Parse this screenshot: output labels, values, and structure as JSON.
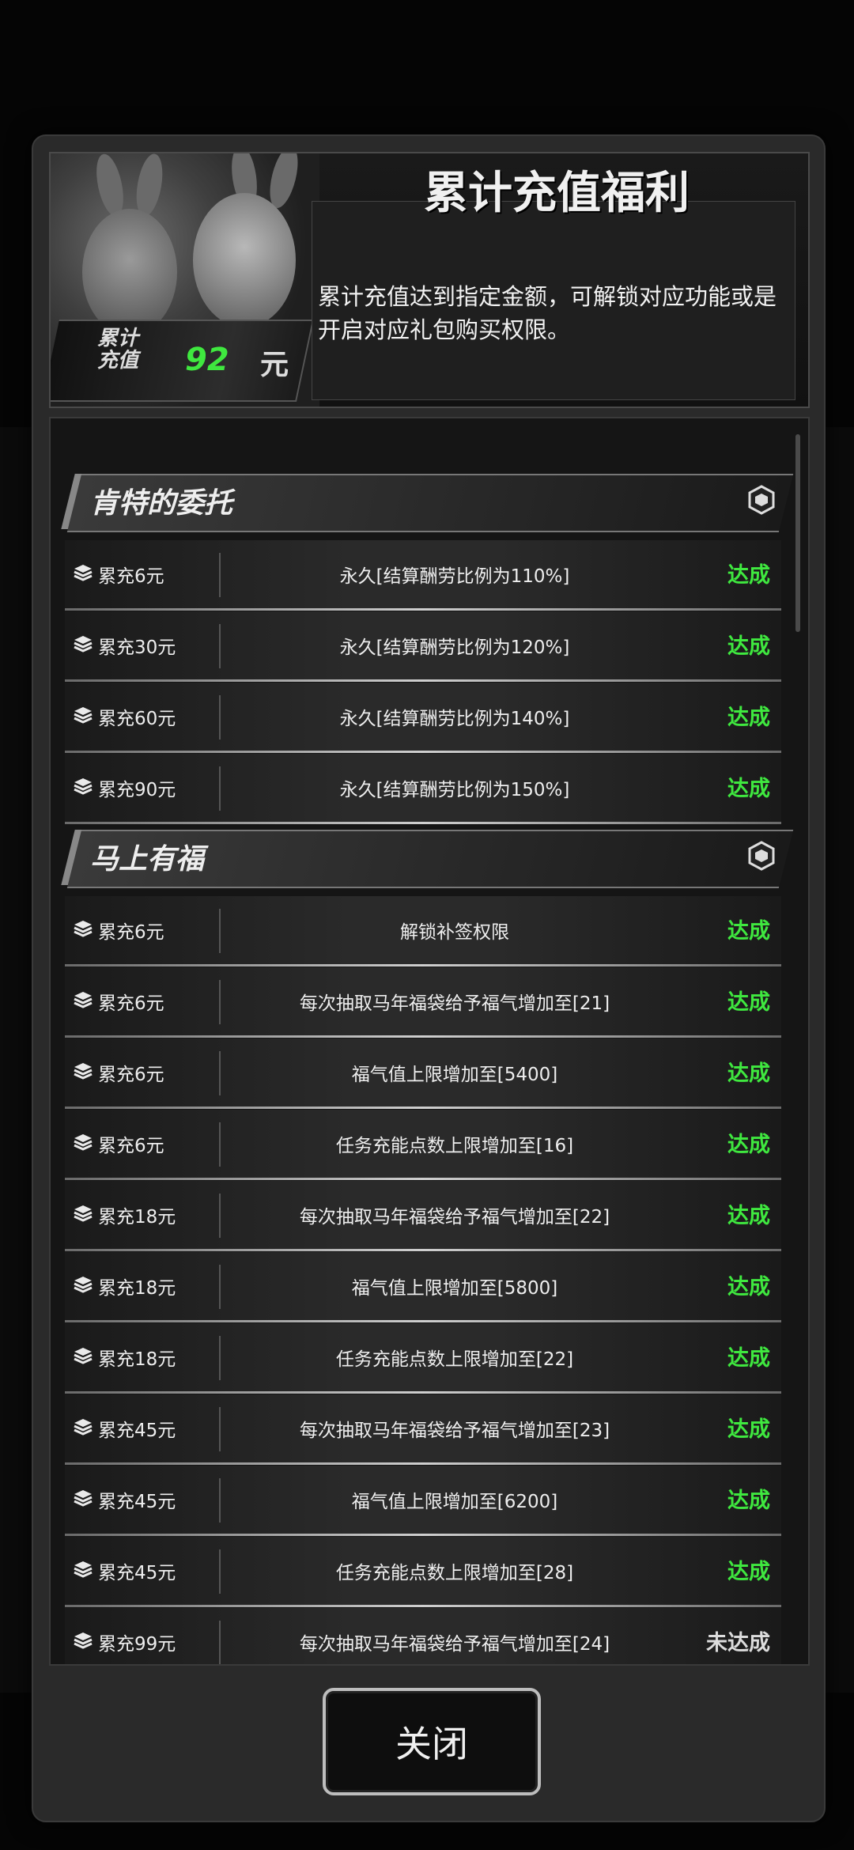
{
  "header": {
    "title": "累计充值福利",
    "description": "累计充值达到指定金额，可解锁对应功能或是开启对应礼包购买权限。",
    "badge_label_line1": "累计",
    "badge_label_line2": "充值",
    "total_amount": "92",
    "currency": "元"
  },
  "sections": [
    {
      "title": "肯特的委托",
      "rows": [
        {
          "req": "累充6元",
          "text": "永久[结算酬劳比例为110%]",
          "status": "达成"
        },
        {
          "req": "累充30元",
          "text": "永久[结算酬劳比例为120%]",
          "status": "达成"
        },
        {
          "req": "累充60元",
          "text": "永久[结算酬劳比例为140%]",
          "status": "达成"
        },
        {
          "req": "累充90元",
          "text": "永久[结算酬劳比例为150%]",
          "status": "达成"
        }
      ]
    },
    {
      "title": "马上有福",
      "rows": [
        {
          "req": "累充6元",
          "text": "解锁补签权限",
          "status": "达成"
        },
        {
          "req": "累充6元",
          "text": "每次抽取马年福袋给予福气增加至[21]",
          "status": "达成"
        },
        {
          "req": "累充6元",
          "text": "福气值上限增加至[5400]",
          "status": "达成"
        },
        {
          "req": "累充6元",
          "text": "任务充能点数上限增加至[16]",
          "status": "达成"
        },
        {
          "req": "累充18元",
          "text": "每次抽取马年福袋给予福气增加至[22]",
          "status": "达成"
        },
        {
          "req": "累充18元",
          "text": "福气值上限增加至[5800]",
          "status": "达成"
        },
        {
          "req": "累充18元",
          "text": "任务充能点数上限增加至[22]",
          "status": "达成"
        },
        {
          "req": "累充45元",
          "text": "每次抽取马年福袋给予福气增加至[23]",
          "status": "达成"
        },
        {
          "req": "累充45元",
          "text": "福气值上限增加至[6200]",
          "status": "达成"
        },
        {
          "req": "累充45元",
          "text": "任务充能点数上限增加至[28]",
          "status": "达成"
        },
        {
          "req": "累充99元",
          "text": "每次抽取马年福袋给予福气增加至[24]",
          "status": "未达成"
        }
      ]
    }
  ],
  "close_button": "关闭",
  "colors": {
    "achieved": "#3fe83f",
    "pending": "#dcdcdc",
    "panel": "#2a2a2a"
  }
}
